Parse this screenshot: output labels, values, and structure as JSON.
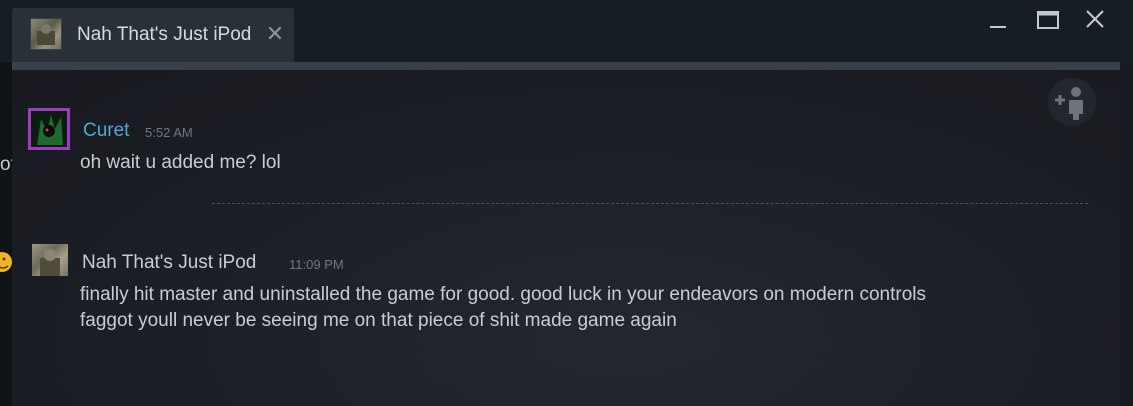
{
  "window": {
    "tab": {
      "title": "Nah That's Just iPod",
      "close_glyph": "✕",
      "avatar_icon": "user-avatar-icon"
    },
    "controls": {
      "minimize_icon": "minimize-icon",
      "maximize_icon": "maximize-icon",
      "close_icon": "close-icon"
    }
  },
  "chat": {
    "add_friend_icon": "add-friend-icon",
    "messages": [
      {
        "sender": "Curet",
        "time": "5:52 AM",
        "lines": [
          "oh wait u added me? lol"
        ],
        "name_color": "#4fa8d8"
      },
      {
        "sender": "Nah That's Just iPod",
        "time": "11:09 PM",
        "lines": [
          "finally hit master and uninstalled the game for good. good luck in your endeavors on modern controls",
          "faggot youll never be seeing me on that piece of shit made game again"
        ],
        "name_color": "#c8cdd2"
      }
    ]
  },
  "colors": {
    "accent_purple": "#9b3cc2",
    "link_blue": "#4fa8d8",
    "background": "#161a21"
  },
  "background_window": {
    "partial_text": "ot",
    "emoji_icon": "emoji-icon"
  }
}
